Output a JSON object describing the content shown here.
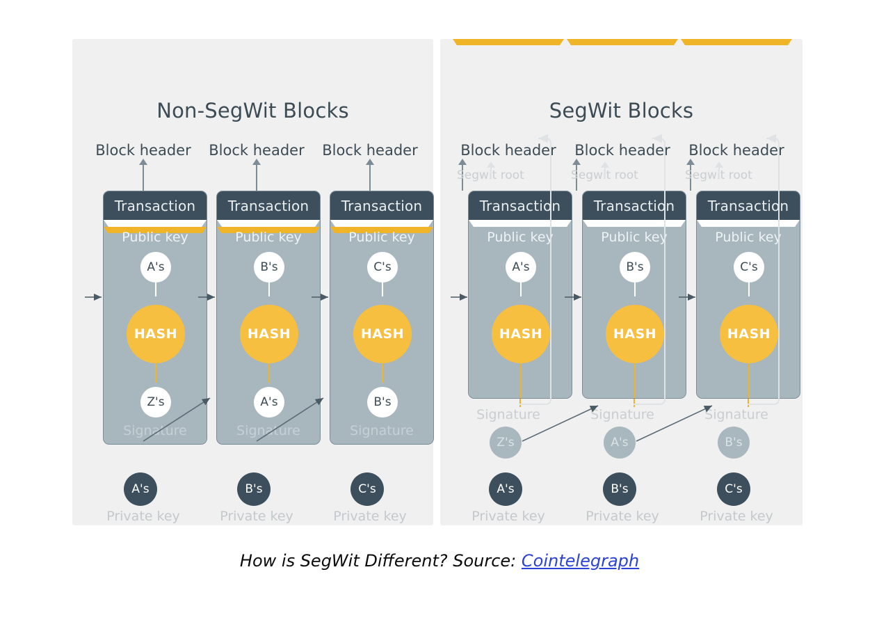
{
  "caption": {
    "text": "How is SegWit Different? Source: ",
    "link_text": "Cointelegraph"
  },
  "colors": {
    "panel_background": "#f0f0f0",
    "page_background": "#ffffff",
    "transaction_header": "#3d4f5c",
    "block_body": "#a8b6be",
    "hash_circle": "#f7bf3f",
    "private_key_circle": "#3d4f5c",
    "segwit_signature_circle": "#a9b7bf",
    "faint_text": "#c9ced1",
    "title_text": "#3c4b54",
    "link": "#2a42d6"
  },
  "panels": [
    {
      "id": "non-segwit",
      "title": "Non-SegWit Blocks",
      "has_segwit_root": false,
      "signature_inside_block": true,
      "blocks": [
        {
          "block_header_label": "Block header",
          "transaction_label": "Transaction",
          "public_key_label": "Public key",
          "public_key_value": "A's",
          "hash_label": "HASH",
          "signature_label": "Signature",
          "signature_value": "Z's",
          "private_key_label": "Private key",
          "private_key_value": "A's"
        },
        {
          "block_header_label": "Block header",
          "transaction_label": "Transaction",
          "public_key_label": "Public key",
          "public_key_value": "B's",
          "hash_label": "HASH",
          "signature_label": "Signature",
          "signature_value": "A's",
          "private_key_label": "Private key",
          "private_key_value": "B's"
        },
        {
          "block_header_label": "Block header",
          "transaction_label": "Transaction",
          "public_key_label": "Public key",
          "public_key_value": "C's",
          "hash_label": "HASH",
          "signature_label": "Signature",
          "signature_value": "B's",
          "private_key_label": "Private key",
          "private_key_value": "C's"
        }
      ]
    },
    {
      "id": "segwit",
      "title": "SegWit Blocks",
      "has_segwit_root": true,
      "signature_inside_block": false,
      "blocks": [
        {
          "block_header_label": "Block header",
          "segwit_root_label": "Segwit root",
          "transaction_label": "Transaction",
          "public_key_label": "Public key",
          "public_key_value": "A's",
          "hash_label": "HASH",
          "signature_label": "Signature",
          "signature_value": "Z's",
          "private_key_label": "Private key",
          "private_key_value": "A's"
        },
        {
          "block_header_label": "Block header",
          "segwit_root_label": "Segwit root",
          "transaction_label": "Transaction",
          "public_key_label": "Public key",
          "public_key_value": "B's",
          "hash_label": "HASH",
          "signature_label": "Signature",
          "signature_value": "A's",
          "private_key_label": "Private key",
          "private_key_value": "B's"
        },
        {
          "block_header_label": "Block header",
          "segwit_root_label": "Segwit root",
          "transaction_label": "Transaction",
          "public_key_label": "Public key",
          "public_key_value": "C's",
          "hash_label": "HASH",
          "signature_label": "Signature",
          "signature_value": "B's",
          "private_key_label": "Private key",
          "private_key_value": "C's"
        }
      ]
    }
  ]
}
